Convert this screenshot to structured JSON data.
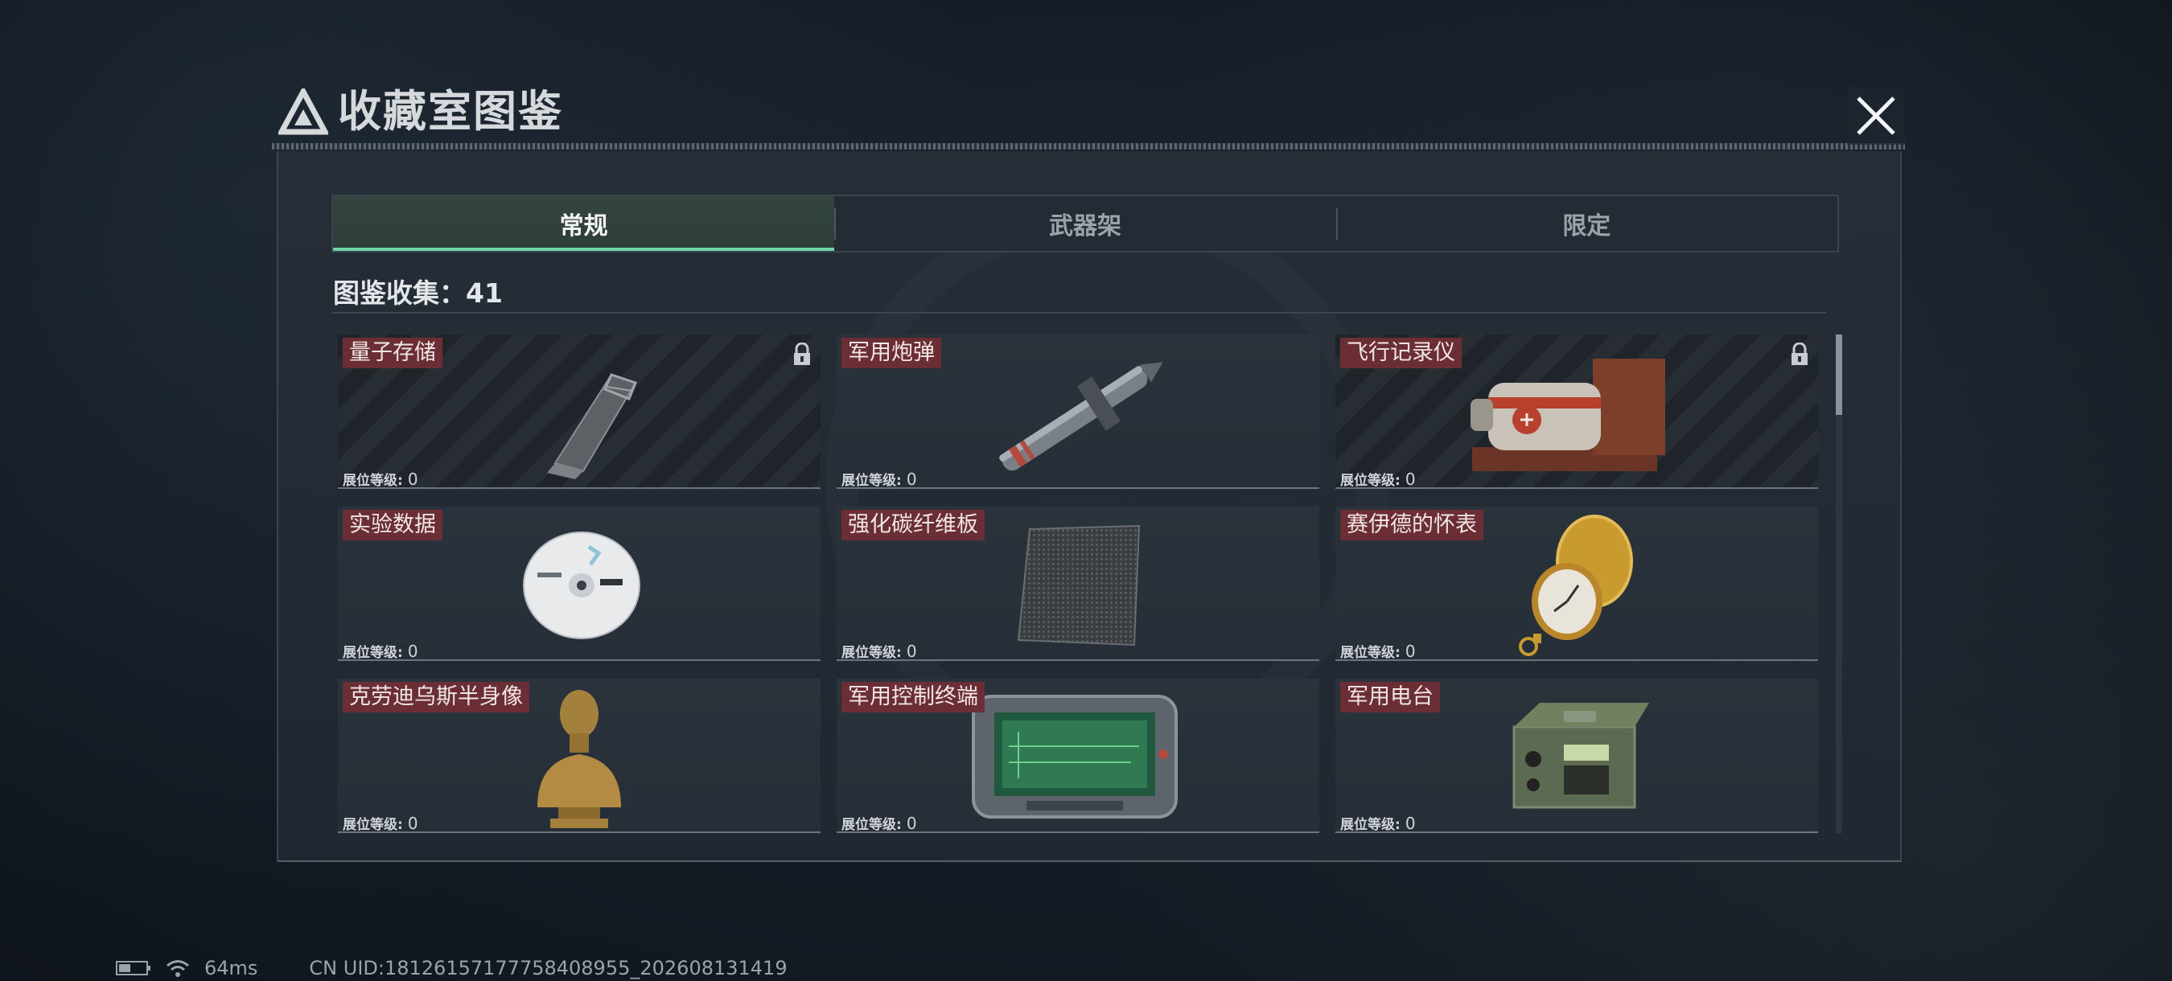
{
  "window": {
    "title": "收藏室图鉴",
    "close_icon": "close-icon"
  },
  "tabs": [
    {
      "label": "常规",
      "active": true
    },
    {
      "label": "武器架",
      "active": false
    },
    {
      "label": "限定",
      "active": false
    }
  ],
  "collection": {
    "label": "图鉴收集：41"
  },
  "items": [
    {
      "name": "量子存储",
      "level_label": "展位等级:",
      "level": "0",
      "locked": true,
      "icon": "usb-drive-icon"
    },
    {
      "name": "军用炮弹",
      "level_label": "展位等级:",
      "level": "0",
      "locked": false,
      "icon": "missile-icon"
    },
    {
      "name": "飞行记录仪",
      "level_label": "展位等级:",
      "level": "0",
      "locked": true,
      "icon": "flight-recorder-icon"
    },
    {
      "name": "实验数据",
      "level_label": "展位等级:",
      "level": "0",
      "locked": false,
      "icon": "disc-icon"
    },
    {
      "name": "强化碳纤维板",
      "level_label": "展位等级:",
      "level": "0",
      "locked": false,
      "icon": "carbon-plate-icon"
    },
    {
      "name": "赛伊德的怀表",
      "level_label": "展位等级:",
      "level": "0",
      "locked": false,
      "icon": "pocket-watch-icon"
    },
    {
      "name": "克劳迪乌斯半身像",
      "level_label": "展位等级:",
      "level": "0",
      "locked": false,
      "icon": "bust-icon"
    },
    {
      "name": "军用控制终端",
      "level_label": "展位等级:",
      "level": "0",
      "locked": false,
      "icon": "terminal-icon"
    },
    {
      "name": "军用电台",
      "level_label": "展位等级:",
      "level": "0",
      "locked": false,
      "icon": "radio-icon"
    }
  ],
  "status_bar": {
    "battery_icon": "battery-icon",
    "wifi_icon": "wifi-icon",
    "ping": "64ms",
    "uid": "CN UID:18126157177758408955_202608131419"
  },
  "colors": {
    "accent": "#6fd6a6",
    "name_tag": "#6b2e34",
    "background": "#141b24"
  }
}
